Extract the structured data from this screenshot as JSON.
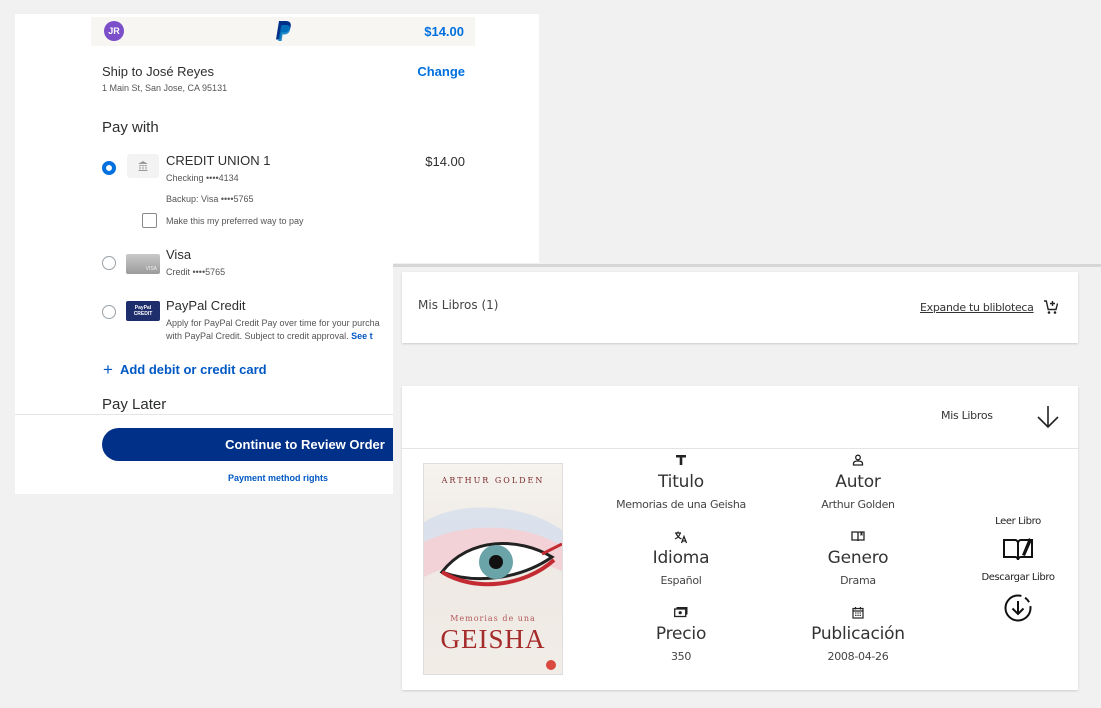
{
  "paypal": {
    "avatar_initials": "JR",
    "amount_total": "$14.00",
    "ship_to": "Ship to José Reyes",
    "address": "1 Main St, San Jose, CA 95131",
    "change_label": "Change",
    "pay_with_title": "Pay with",
    "methods": [
      {
        "name": "CREDIT UNION 1",
        "line1": "Checking ••••4134",
        "line2": "Backup: Visa ••••5765",
        "amount": "$14.00",
        "selected": true
      },
      {
        "name": "Visa",
        "line1": "Credit ••••5765",
        "selected": false
      },
      {
        "name": "PayPal Credit",
        "line1": "Apply for PayPal Credit Pay over time for your purcha",
        "line2": "with PayPal Credit. Subject to credit approval.",
        "line2_link": "See t",
        "selected": false
      }
    ],
    "preferred_label": "Make this my preferred way to pay",
    "add_card_label": "Add debit or credit card",
    "pay_later_title": "Pay Later",
    "continue_label": "Continue to Review Order",
    "payment_rights_label": "Payment method rights",
    "colors": {
      "accent": "#0070e0",
      "button": "#003087",
      "avatar": "#7b4fc9"
    }
  },
  "library": {
    "summary_title": "Mis Libros (1)",
    "expand_link": "Expande tu blibloteca",
    "section_title": "Mis Libros",
    "book": {
      "cover_author": "ARTHUR GOLDEN",
      "cover_subtitle": "Memorias de una",
      "cover_title": "GEISHA",
      "fields": [
        {
          "icon": "text-icon",
          "label": "Titulo",
          "value": "Memorias de una Geisha"
        },
        {
          "icon": "person-icon",
          "label": "Autor",
          "value": "Arthur Golden"
        },
        {
          "icon": "translate-icon",
          "label": "Idioma",
          "value": "Español"
        },
        {
          "icon": "book-icon",
          "label": "Genero",
          "value": "Drama"
        },
        {
          "icon": "money-icon",
          "label": "Precio",
          "value": "350"
        },
        {
          "icon": "calendar-icon",
          "label": "Publicación",
          "value": "2008-04-26"
        }
      ],
      "read_label": "Leer Libro",
      "download_label": "Descargar Libro"
    }
  }
}
